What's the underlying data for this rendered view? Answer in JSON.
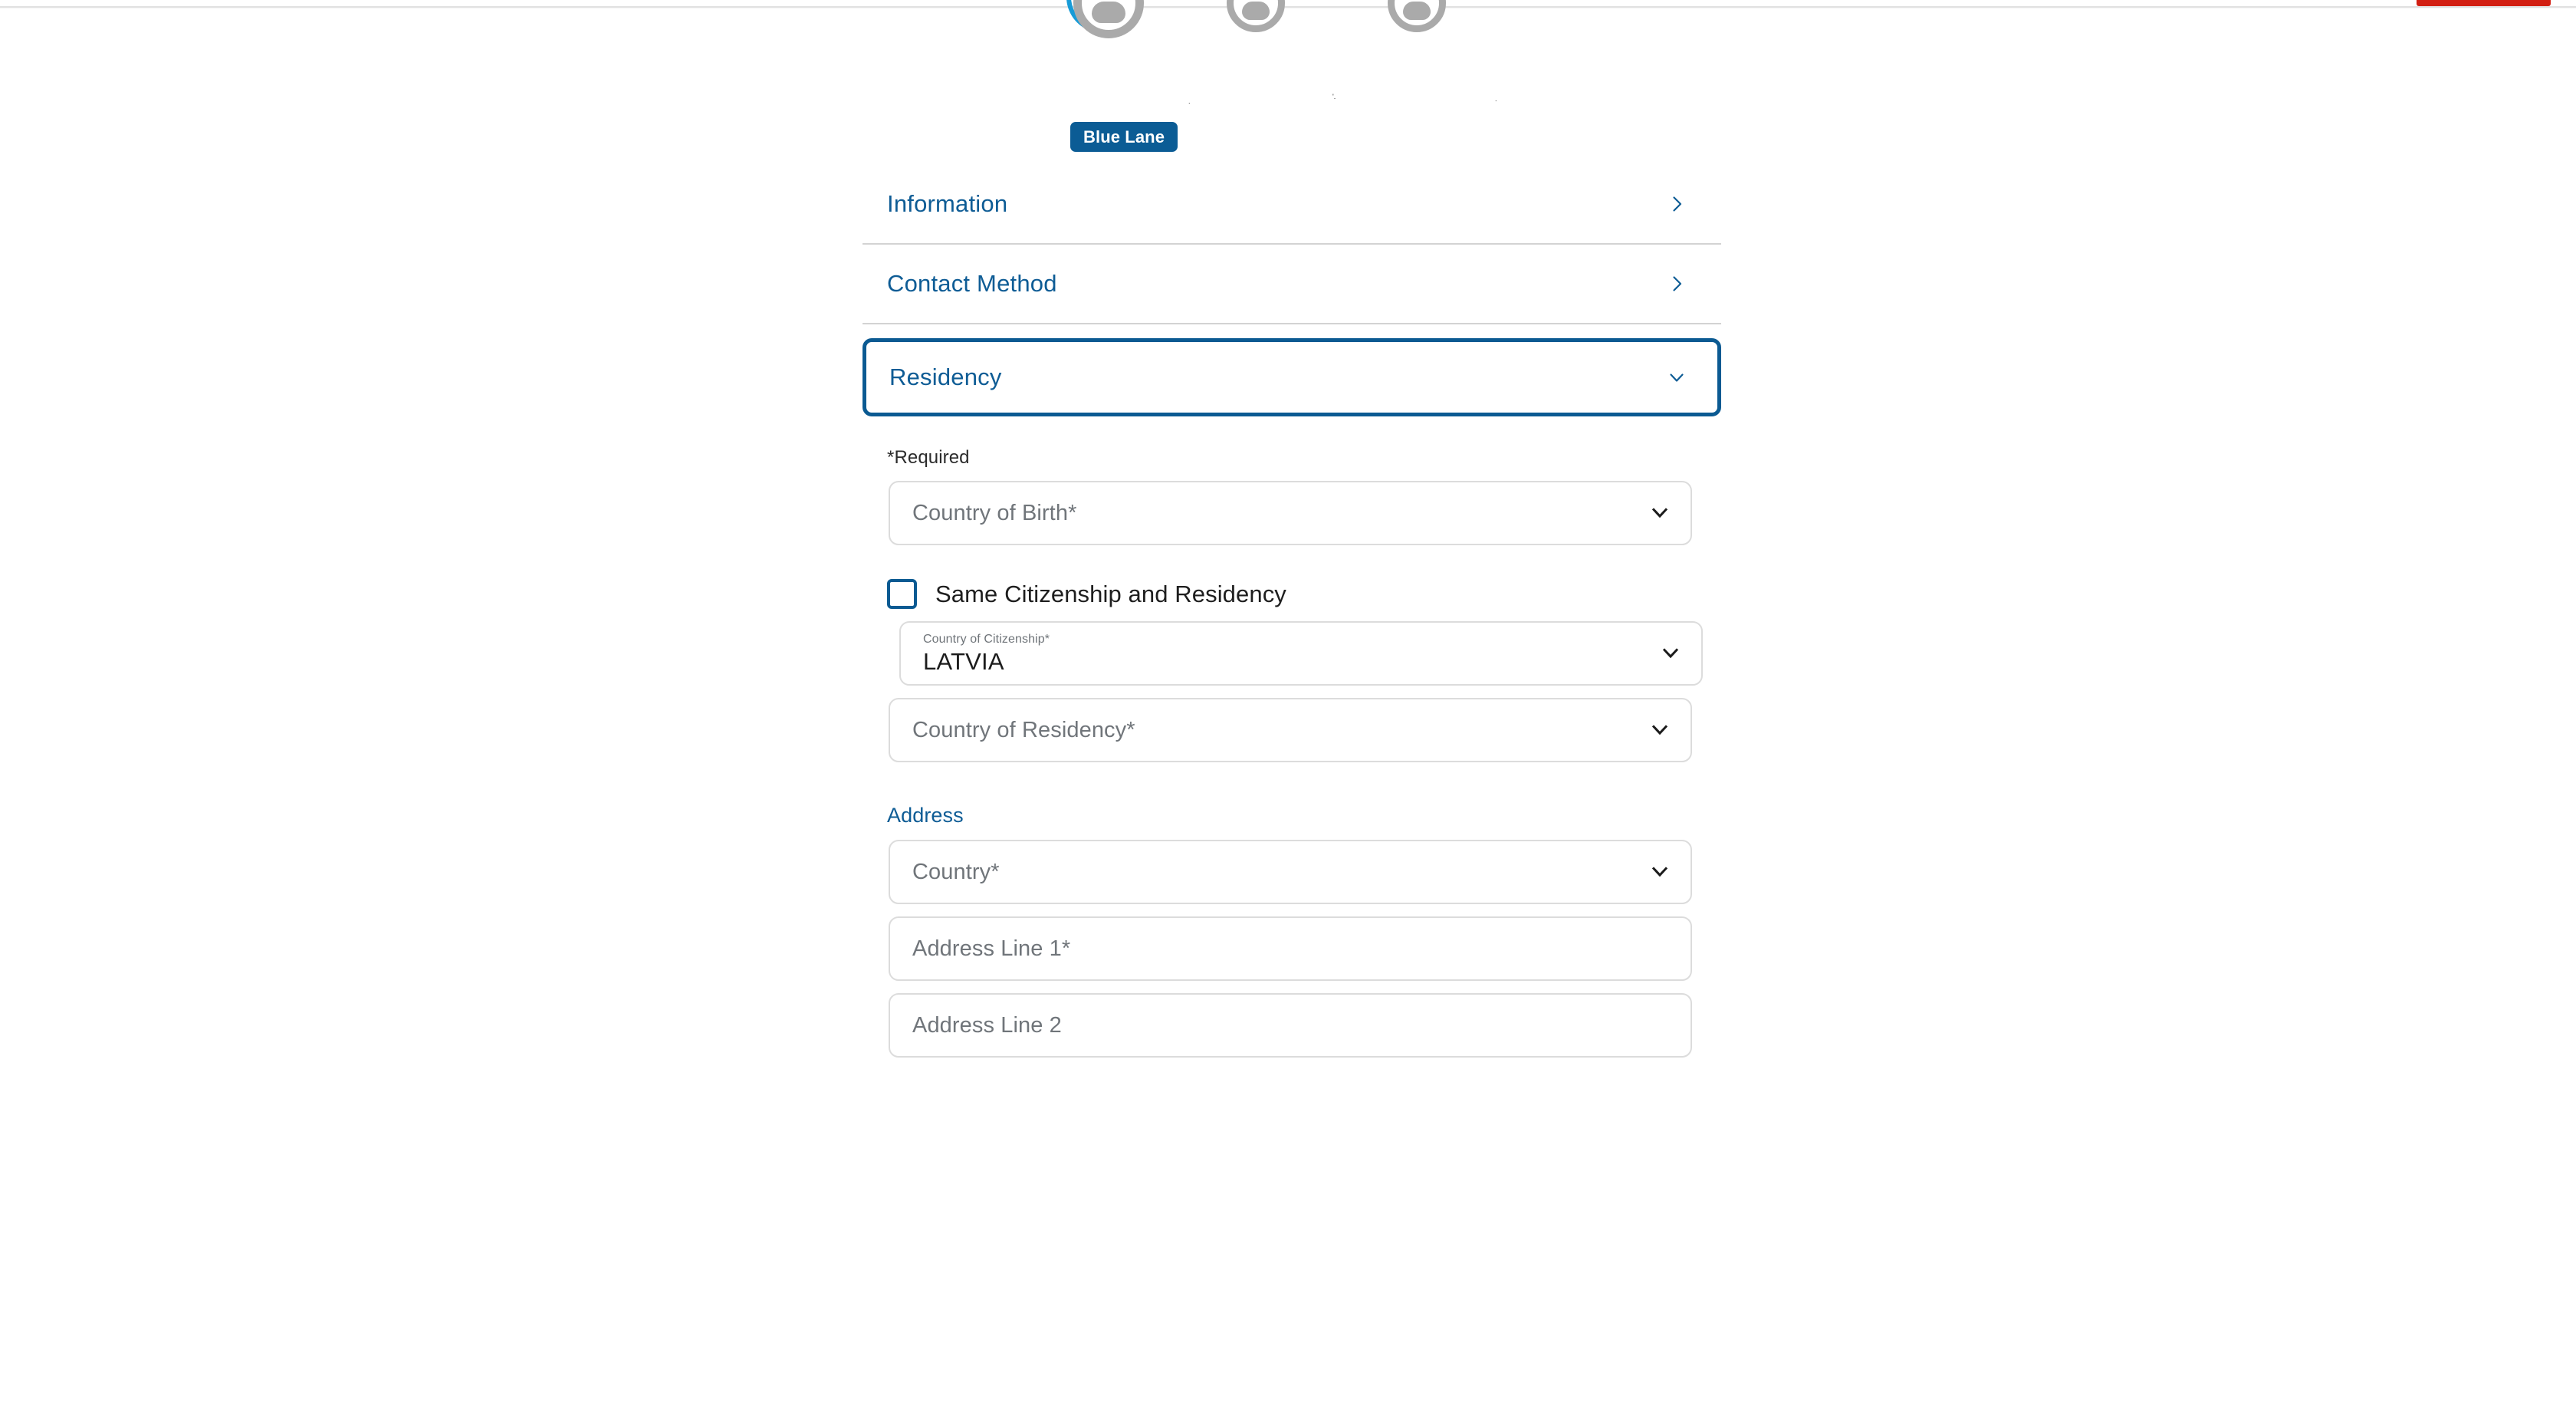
{
  "theme": {
    "brand_blue": "#0e5c95",
    "focus_blue": "#0b5a92",
    "selected_ring_blue": "#179bd7",
    "badge_orange": "#e8703a",
    "alert_red": "#d21f12",
    "avatar_gray": "#aaaaaa",
    "field_border": "#dcdcdc",
    "placeholder_gray": "#70757a"
  },
  "avatars": {
    "items": [
      {
        "name": "avatar-1",
        "selected": true,
        "has_badge": false,
        "caption": "."
      },
      {
        "name": "avatar-2",
        "selected": false,
        "has_badge": true,
        "caption": "'."
      },
      {
        "name": "avatar-3",
        "selected": false,
        "has_badge": true,
        "caption": "."
      }
    ],
    "selected_badge_label": "Blue Lane"
  },
  "accordion": {
    "items": [
      {
        "label": "Information",
        "expanded": false,
        "chevron": "chevron-right-icon"
      },
      {
        "label": "Contact Method",
        "expanded": false,
        "chevron": "chevron-right-icon"
      },
      {
        "label": "Residency",
        "expanded": true,
        "chevron": "chevron-down-icon"
      }
    ]
  },
  "residency": {
    "required_note": "*Required",
    "country_of_birth": {
      "placeholder": "Country of Birth*",
      "value": "",
      "chevron": "chevron-down-icon"
    },
    "same_citizenship_checkbox": {
      "label": "Same Citizenship and Residency",
      "checked": false
    },
    "country_of_citizenship": {
      "float_label": "Country of Citizenship*",
      "value": "LATVIA",
      "chevron": "chevron-down-icon"
    },
    "country_of_residency": {
      "placeholder": "Country of Residency*",
      "value": "",
      "chevron": "chevron-down-icon"
    },
    "address": {
      "section_title": "Address",
      "country": {
        "placeholder": "Country*",
        "value": "",
        "chevron": "chevron-down-icon"
      },
      "address_line_1": {
        "placeholder": "Address Line 1*",
        "value": ""
      },
      "address_line_2": {
        "placeholder": "Address Line 2",
        "value": ""
      }
    }
  }
}
